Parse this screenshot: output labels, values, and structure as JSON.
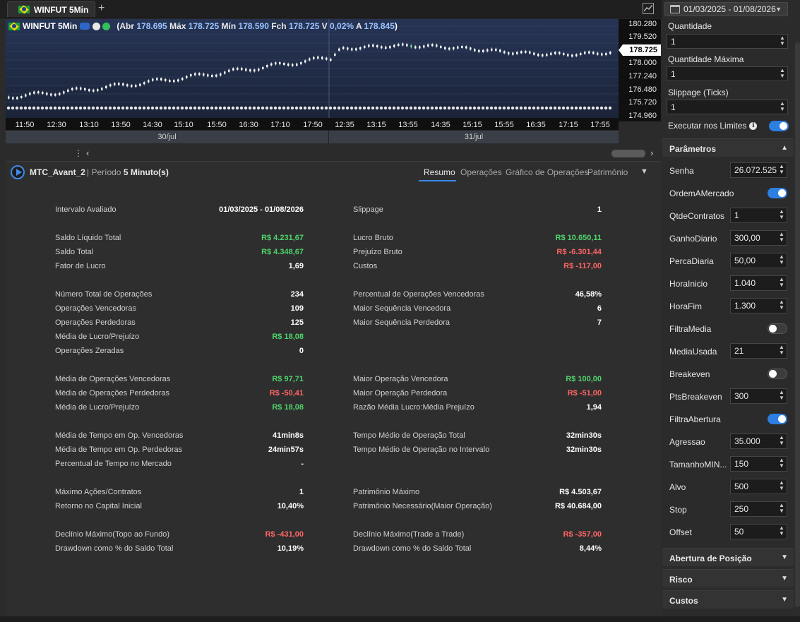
{
  "tab": {
    "title": "WINFUT 5Min"
  },
  "chart": {
    "symbol": "WINFUT 5Min",
    "ohlc": [
      {
        "label": "Abr",
        "value": "178.695"
      },
      {
        "label": "Máx",
        "value": "178.725"
      },
      {
        "label": "Mín",
        "value": "178.590"
      },
      {
        "label": "Fch",
        "value": "178.725"
      },
      {
        "label": "V",
        "value": "0,02%"
      },
      {
        "label": "A",
        "value": "178.845"
      }
    ],
    "y_ticks": [
      "180.280",
      "179.520",
      "178.725",
      "178.000",
      "177.240",
      "176.480",
      "175.720",
      "174.960"
    ],
    "current_price": "178.725",
    "x_ticks": [
      "11:50",
      "12:30",
      "13:10",
      "13:50",
      "14:30",
      "15:10",
      "15:50",
      "16:30",
      "17:10",
      "17:50",
      "12:35",
      "13:15",
      "13:55",
      "14:35",
      "15:15",
      "15:55",
      "16:35",
      "17:15",
      "17:55"
    ],
    "dates": [
      "30/jul",
      "31/jul"
    ],
    "accent": "#3b8bea"
  },
  "report": {
    "strategy": "MTC_Avant_2",
    "period_label": "| Período",
    "period_value": "5 Minuto(s)",
    "tabs": [
      "Resumo",
      "Operações",
      "Gráfico de Operações",
      "Patrimônio"
    ],
    "left": [
      {
        "label": "Intervalo Avaliado",
        "value": "01/03/2025 - 01/08/2026",
        "status": ""
      },
      {
        "label": "Saldo Líquido Total",
        "value": "R$ 4.231,67",
        "status": "pos"
      },
      {
        "label": "Saldo Total",
        "value": "R$ 4.348,67",
        "status": "pos"
      },
      {
        "label": "Fator de Lucro",
        "value": "1,69",
        "status": ""
      },
      {
        "label": "Número Total de Operações",
        "value": "234",
        "status": ""
      },
      {
        "label": "Operações Vencedoras",
        "value": "109",
        "status": ""
      },
      {
        "label": "Operações Perdedoras",
        "value": "125",
        "status": ""
      },
      {
        "label": "Média de Lucro/Prejuízo",
        "value": "R$ 18,08",
        "status": "pos"
      },
      {
        "label": "Operações Zeradas",
        "value": "0",
        "status": ""
      },
      {
        "label": "Média de Operações Vencedoras",
        "value": "R$ 97,71",
        "status": "pos"
      },
      {
        "label": "Média de Operações Perdedoras",
        "value": "R$ -50,41",
        "status": "neg"
      },
      {
        "label": "Média de Lucro/Prejuízo",
        "value": "R$ 18,08",
        "status": "pos"
      },
      {
        "label": "Média de Tempo em Op. Vencedoras",
        "value": "41min8s",
        "status": ""
      },
      {
        "label": "Média de Tempo em Op. Perdedoras",
        "value": "24min57s",
        "status": ""
      },
      {
        "label": "Percentual de Tempo no Mercado",
        "value": "-",
        "status": ""
      },
      {
        "label": "Máximo Ações/Contratos",
        "value": "1",
        "status": ""
      },
      {
        "label": "Retorno no Capital Inicial",
        "value": "10,40%",
        "status": ""
      },
      {
        "label": "Declínio Máximo(Topo ao Fundo)",
        "value": "R$ -431,00",
        "status": "neg"
      },
      {
        "label": "Drawdown como % do Saldo Total",
        "value": "10,19%",
        "status": ""
      }
    ],
    "right": [
      {
        "label": "Slippage",
        "value": "1",
        "status": ""
      },
      {
        "label": "Lucro Bruto",
        "value": "R$ 10.650,11",
        "status": "pos"
      },
      {
        "label": "Prejuízo Bruto",
        "value": "R$ -6.301,44",
        "status": "neg"
      },
      {
        "label": "Custos",
        "value": "R$ -117,00",
        "status": "neg"
      },
      {
        "label": "Percentual de Operações Vencedoras",
        "value": "46,58%",
        "status": ""
      },
      {
        "label": "Maior Sequência Vencedora",
        "value": "6",
        "status": ""
      },
      {
        "label": "Maior Sequência Perdedora",
        "value": "7",
        "status": ""
      },
      {
        "label": "Maior Operação Vencedora",
        "value": "R$ 100,00",
        "status": "pos"
      },
      {
        "label": "Maior Operação Perdedora",
        "value": "R$ -51,00",
        "status": "neg"
      },
      {
        "label": "Razão Média Lucro:Média Prejuízo",
        "value": "1,94",
        "status": ""
      },
      {
        "label": "Tempo Médio de Operação Total",
        "value": "32min30s",
        "status": ""
      },
      {
        "label": "Tempo Médio de Operação no Intervalo",
        "value": "32min30s",
        "status": ""
      },
      {
        "label": "Patrimônio Máximo",
        "value": "R$ 4.503,67",
        "status": ""
      },
      {
        "label": "Patrimônio Necessário(Maior Operação)",
        "value": "R$ 40.684,00",
        "status": ""
      },
      {
        "label": "Declínio Máximo(Trade a Trade)",
        "value": "R$ -357,00",
        "status": "neg"
      },
      {
        "label": "Drawdown como % do Saldo Total",
        "value": "8,44%",
        "status": ""
      }
    ]
  },
  "side": {
    "date_range": "01/03/2025 - 01/08/2026",
    "quantidade_label": "Quantidade",
    "quantidade": "1",
    "quantidade_max_label": "Quantidade Máxima",
    "quantidade_max": "1",
    "slippage_label": "Slippage (Ticks)",
    "slippage": "1",
    "executar_label": "Executar nos Limites",
    "executar_on": true,
    "params_title": "Parâmetros",
    "params": [
      {
        "label": "Senha",
        "type": "input",
        "value": "26.072.525"
      },
      {
        "label": "OrdemAMercado",
        "type": "toggle",
        "on": true
      },
      {
        "label": "QtdeContratos",
        "type": "input",
        "value": "1"
      },
      {
        "label": "GanhoDiario",
        "type": "input",
        "value": "300,00"
      },
      {
        "label": "PercaDiaria",
        "type": "input",
        "value": "50,00"
      },
      {
        "label": "HoraInicio",
        "type": "input",
        "value": "1.040"
      },
      {
        "label": "HoraFim",
        "type": "input",
        "value": "1.300"
      },
      {
        "label": "FiltraMedia",
        "type": "toggle",
        "on": false
      },
      {
        "label": "MediaUsada",
        "type": "input",
        "value": "21"
      },
      {
        "label": "Breakeven",
        "type": "toggle",
        "on": false
      },
      {
        "label": "PtsBreakeven",
        "type": "input",
        "value": "300"
      },
      {
        "label": "FiltraAbertura",
        "type": "toggle",
        "on": true
      },
      {
        "label": "Agressao",
        "type": "input",
        "value": "35.000"
      },
      {
        "label": "TamanhoMIN...",
        "type": "input",
        "value": "150"
      },
      {
        "label": "Alvo",
        "type": "input",
        "value": "500"
      },
      {
        "label": "Stop",
        "type": "input",
        "value": "250"
      },
      {
        "label": "Offset",
        "type": "input",
        "value": "50"
      }
    ],
    "sections": [
      "Abertura de Posição",
      "Risco",
      "Custos"
    ]
  }
}
